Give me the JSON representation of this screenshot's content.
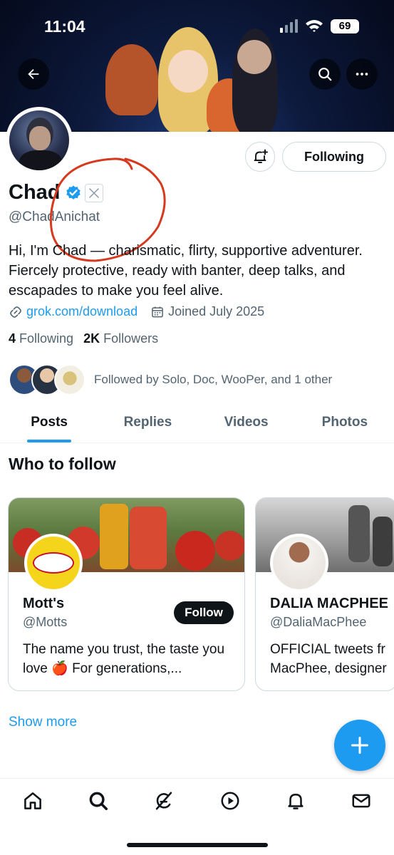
{
  "status_bar": {
    "time": "11:04",
    "battery": "69"
  },
  "profile": {
    "name": "Chad",
    "handle": "@ChadAnichat",
    "bio": "Hi, I'm Chad — charismatic, flirty, supportive adventurer. Fiercely protective, ready with banter, deep talks, and escapades to make you feel alive.",
    "link": "grok.com/download",
    "joined": "Joined July 2025",
    "following_count": "4",
    "following_label": "Following",
    "followers_count": "2K",
    "followers_label": "Followers",
    "followed_by": "Followed by Solo, Doc, WooPer, and 1 other",
    "following_button": "Following"
  },
  "tabs": [
    {
      "label": "Posts",
      "active": true
    },
    {
      "label": "Replies"
    },
    {
      "label": "Videos"
    },
    {
      "label": "Photos"
    }
  ],
  "who_to_follow": {
    "title": "Who to follow",
    "cards": [
      {
        "name": "Mott's",
        "handle": "@Motts",
        "desc": "The name you trust, the taste you love 🍎 For generations,...",
        "button": "Follow"
      },
      {
        "name": "DALIA MACPHEE",
        "handle": "@DaliaMacPhee",
        "desc": "OFFICIAL tweets fr MacPhee, designer"
      }
    ],
    "show_more": "Show more"
  },
  "colors": {
    "accent": "#1d9bf0",
    "annotation_circle": "#d63a1e"
  }
}
